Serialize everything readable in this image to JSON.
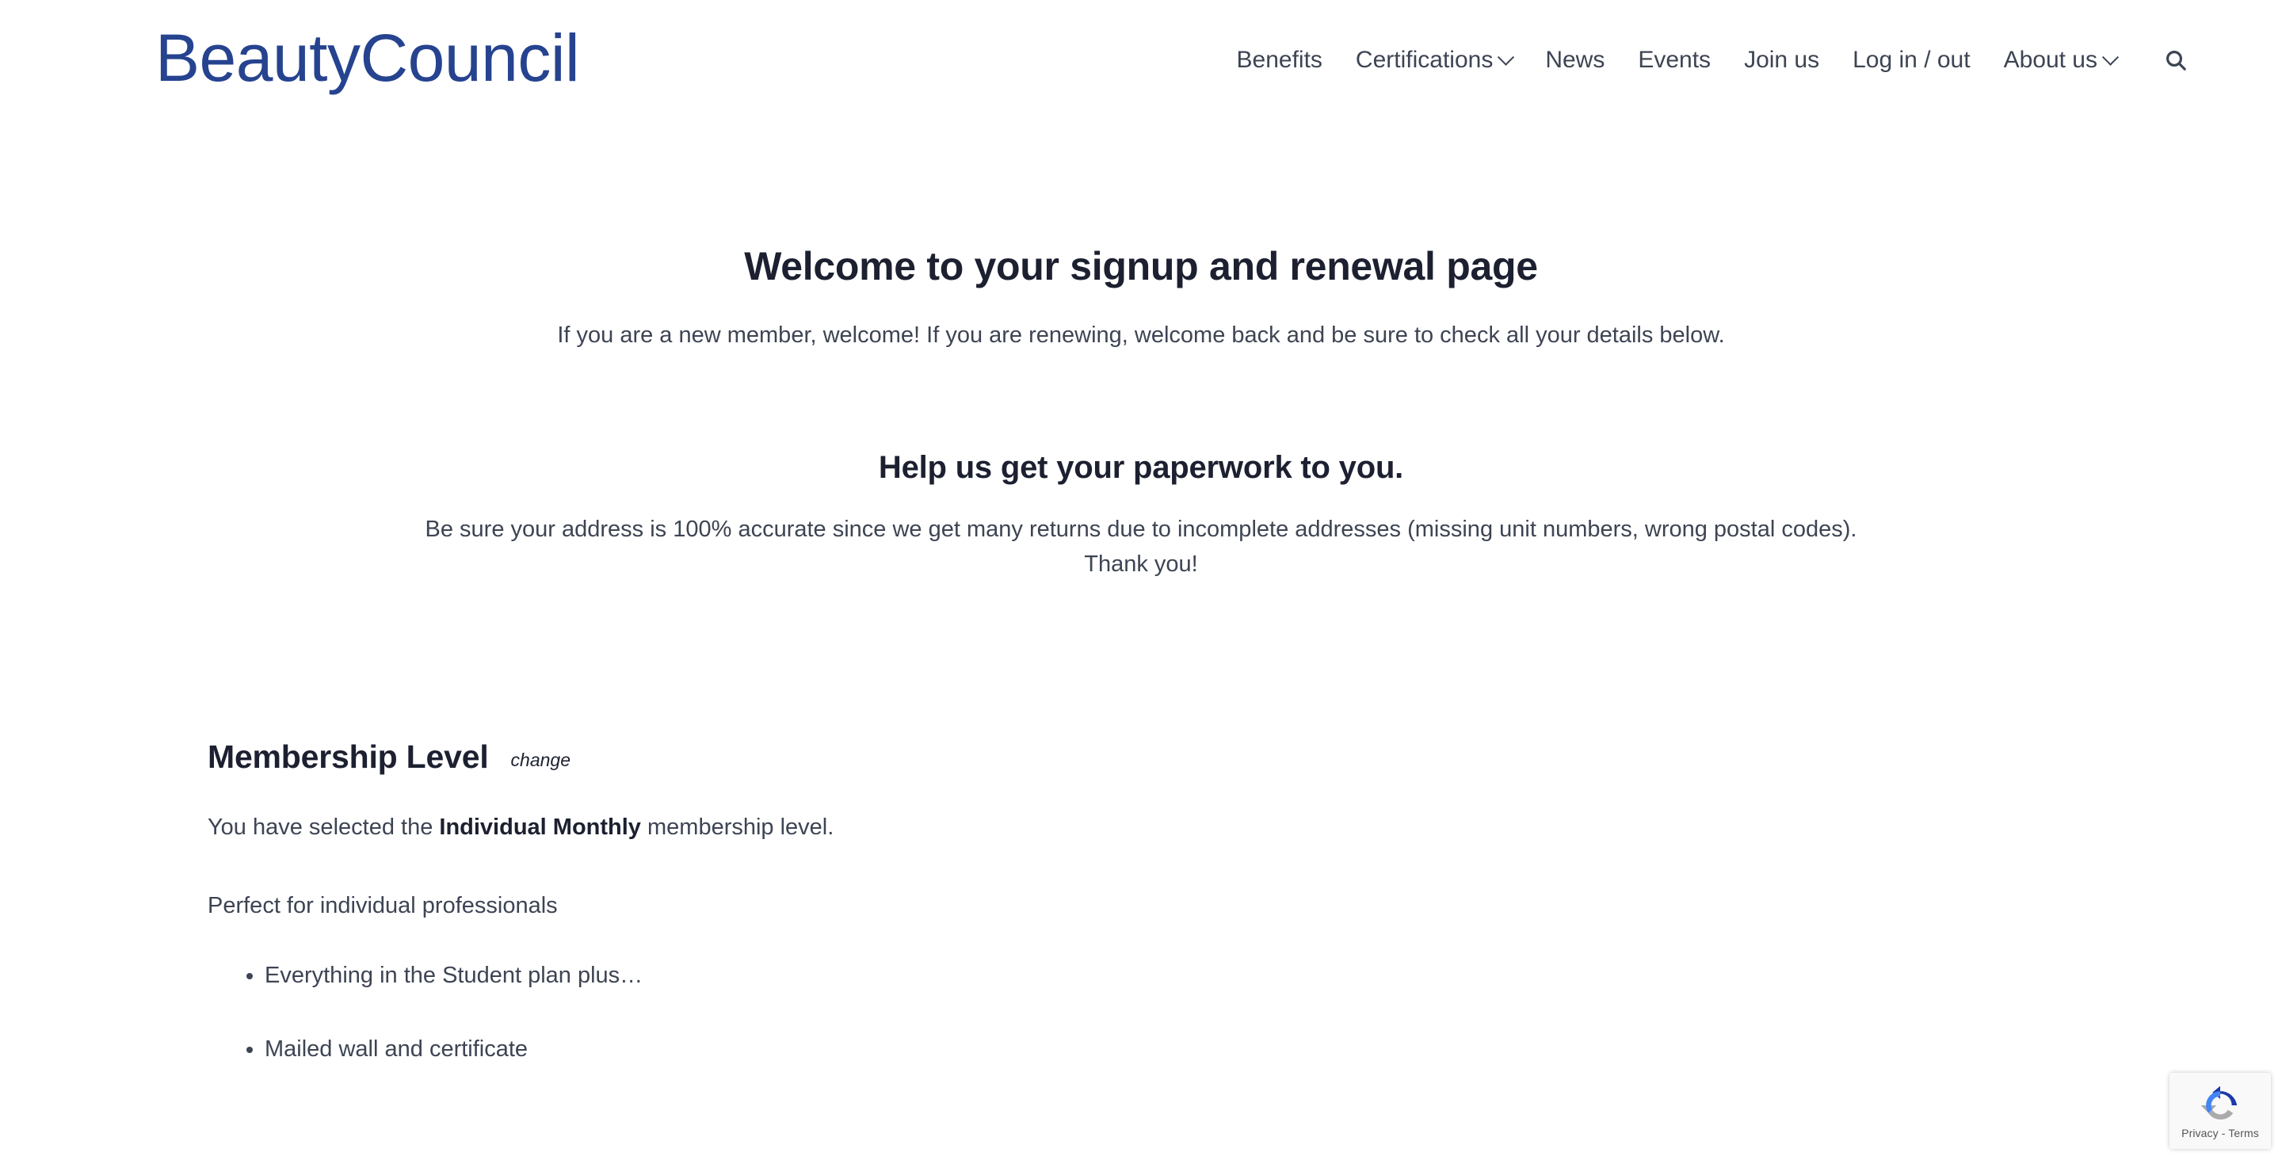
{
  "header": {
    "logo_text": "BeautyCouncil",
    "logo_color": "#26438f",
    "nav": [
      {
        "label": "Benefits",
        "has_dropdown": false
      },
      {
        "label": "Certifications",
        "has_dropdown": true
      },
      {
        "label": "News",
        "has_dropdown": false
      },
      {
        "label": "Events",
        "has_dropdown": false
      },
      {
        "label": "Join us",
        "has_dropdown": false
      },
      {
        "label": "Log in / out",
        "has_dropdown": false
      },
      {
        "label": "About us",
        "has_dropdown": true
      }
    ],
    "search_icon": "search-icon"
  },
  "main": {
    "page_title": "Welcome to your signup and renewal page",
    "intro": "If you are a new member, welcome! If you are renewing, welcome back and be sure to check all your details below.",
    "sub_title": "Help us get your paperwork to you.",
    "note_line1": "Be sure your address is 100% accurate since we get many returns due to incomplete addresses (missing unit numbers, wrong postal codes).",
    "note_line2": "Thank you!"
  },
  "membership": {
    "section_title": "Membership Level",
    "change_label": "change",
    "selected_prefix": "You have selected the ",
    "selected_level": "Individual Monthly",
    "selected_suffix": " membership level.",
    "description": "Perfect for individual professionals",
    "features": [
      "Everything in the Student plan plus…",
      "Mailed wall and certificate"
    ]
  },
  "recaptcha": {
    "privacy_terms": "Privacy - Terms"
  },
  "colors": {
    "brand_blue": "#26438f",
    "heading": "#1c2030",
    "body_text": "#3d4453",
    "page_bg": "#ffffff"
  }
}
